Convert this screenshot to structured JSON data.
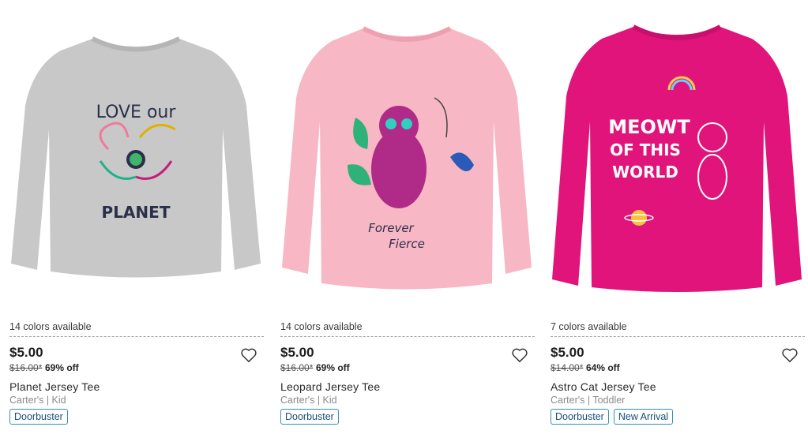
{
  "products": [
    {
      "colors_available": "14 colors available",
      "price": "$5.00",
      "was_price": "$16.00*",
      "discount": "69% off",
      "name": "Planet Jersey Tee",
      "brand_line": "Carter's | Kid",
      "badges": [
        "Doorbuster"
      ],
      "shirt_color": "#c8c8c8",
      "graphic_text": [
        "LOVE our",
        "PLANET"
      ]
    },
    {
      "colors_available": "14 colors available",
      "price": "$5.00",
      "was_price": "$16.00*",
      "discount": "69% off",
      "name": "Leopard Jersey Tee",
      "brand_line": "Carter's | Kid",
      "badges": [
        "Doorbuster"
      ],
      "shirt_color": "#f7b7c5",
      "graphic_text": [
        "Forever",
        "Fierce"
      ]
    },
    {
      "colors_available": "7 colors available",
      "price": "$5.00",
      "was_price": "$14.00*",
      "discount": "64% off",
      "name": "Astro Cat Jersey Tee",
      "brand_line": "Carter's | Toddler",
      "badges": [
        "Doorbuster",
        "New Arrival"
      ],
      "shirt_color": "#e0147a",
      "graphic_text": [
        "MEOWT",
        "OF THIS",
        "WORLD"
      ]
    }
  ],
  "icons": {
    "favorite": "heart-outline-icon"
  }
}
